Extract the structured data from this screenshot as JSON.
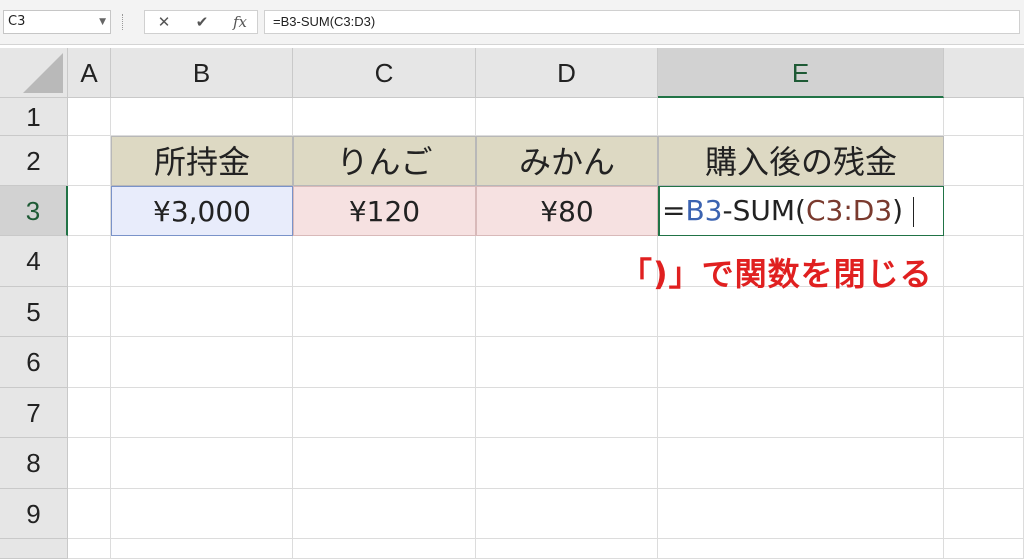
{
  "formula_bar": {
    "name_box": "C3",
    "cancel_icon": "✕",
    "enter_icon": "✔",
    "fx_label": "fx",
    "formula": "=B3-SUM(C3:D3)"
  },
  "columns": [
    "A",
    "B",
    "C",
    "D",
    "E"
  ],
  "rows": [
    "1",
    "2",
    "3",
    "4",
    "5",
    "6",
    "7",
    "8",
    "9"
  ],
  "headers_row2": {
    "B": "所持金",
    "C": "りんご",
    "D": "みかん",
    "E": "購入後の残金"
  },
  "values_row3": {
    "B": "¥3,000",
    "C": "¥120",
    "D": "¥80"
  },
  "editing_formula": {
    "eq": "=",
    "ref1": "B3",
    "mid": "-SUM(",
    "ref2": "C3:D3",
    "close": ")"
  },
  "annotation": "「)」で関数を閉じる",
  "colors": {
    "ref1": "#3b63b1",
    "ref2": "#7a3a2e",
    "annotation": "#e02020",
    "header_fill": "#ddd9c3",
    "selection": "#217346"
  }
}
